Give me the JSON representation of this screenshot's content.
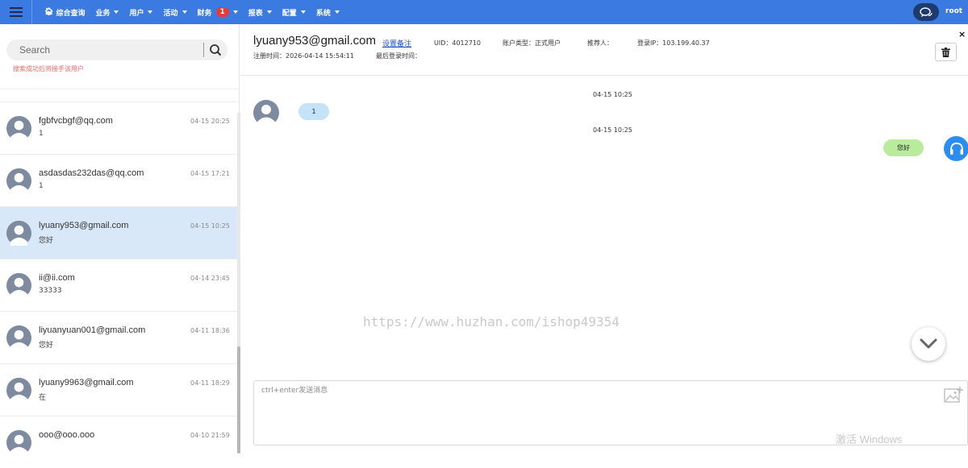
{
  "nav": {
    "items": [
      {
        "label": "综合查询",
        "caret": false
      },
      {
        "label": "业务",
        "caret": true
      },
      {
        "label": "用户",
        "caret": true
      },
      {
        "label": "活动",
        "caret": true
      },
      {
        "label": "财务",
        "caret": true,
        "badge": "1"
      },
      {
        "label": "报表",
        "caret": true
      },
      {
        "label": "配置",
        "caret": true
      },
      {
        "label": "系统",
        "caret": true
      }
    ],
    "user": "root"
  },
  "sidebar": {
    "search_placeholder": "Search",
    "search_hint": "搜索成功后将接手该用户",
    "conversations": [
      {
        "name": "fgbfvcbgf@qq.com",
        "snippet": "1",
        "time": "04-15 20:25",
        "active": false
      },
      {
        "name": "asdasdas232das@qq.com",
        "snippet": "1",
        "time": "04-15 17:21",
        "active": false
      },
      {
        "name": "lyuany953@gmail.com",
        "snippet": "您好",
        "time": "04-15 10:25",
        "active": true
      },
      {
        "name": "ii@ii.com",
        "snippet": "33333",
        "time": "04-14 23:45",
        "active": false
      },
      {
        "name": "liyuanyuan001@gmail.com",
        "snippet": "您好",
        "time": "04-11 18:36",
        "active": false
      },
      {
        "name": "lyuany9963@gmail.com",
        "snippet": "在",
        "time": "04-11 18:29",
        "active": false
      },
      {
        "name": "ooo@ooo.ooo",
        "snippet": "",
        "time": "04-10 21:59",
        "active": false
      }
    ]
  },
  "header": {
    "email": "lyuany953@gmail.com",
    "remark_link": "设置备注",
    "uid": "UID：4012710",
    "account_type": "账户类型：正式用户",
    "referrer": "推荐人：",
    "login_ip": "登录IP：103.199.40.37",
    "register_time": "注册时间：2026-04-14 15:54:11",
    "last_login": "最后登录时间：",
    "close": "×"
  },
  "messages": {
    "time1": "04-15 10:25",
    "incoming": "1",
    "time2": "04-15 10:25",
    "outgoing": "您好"
  },
  "watermark": "https://www.huzhan.com/ishop49354",
  "compose": {
    "placeholder": "ctrl+enter发送消息"
  },
  "os_watermark": "激活 Windows",
  "colors": {
    "nav_bg": "#3b7ae0",
    "badge": "#e33b3b",
    "active_row": "#d8e8f8",
    "incoming_bubble": "#c4e2f8",
    "outgoing_bubble": "#b8ec9c",
    "agent_avatar": "#2c8cf0"
  }
}
